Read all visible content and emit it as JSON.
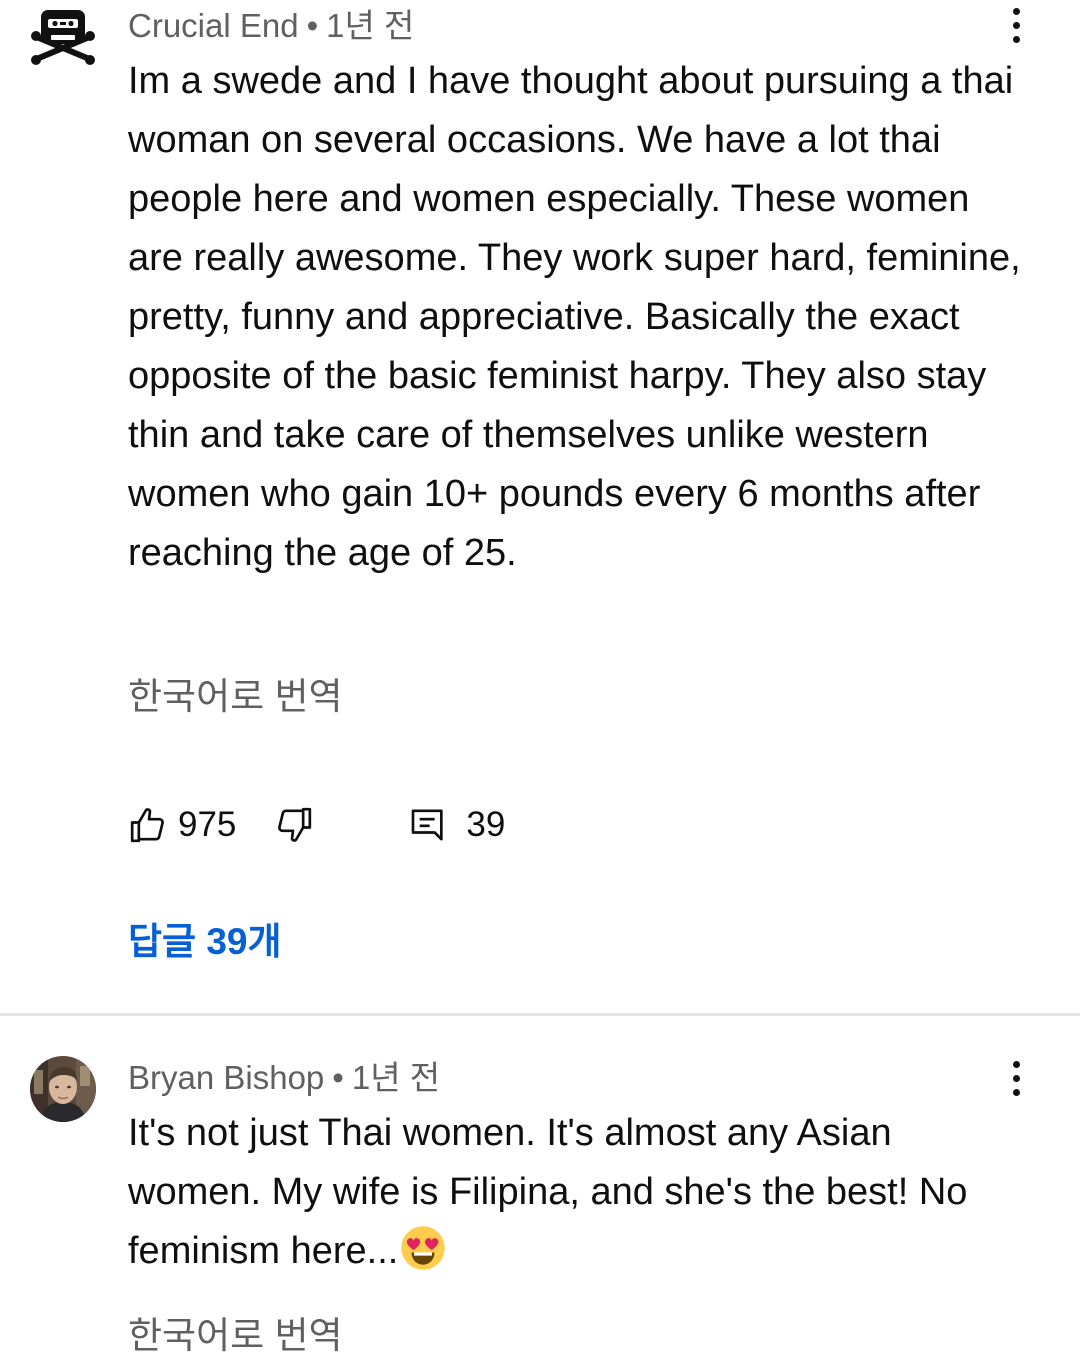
{
  "comments": [
    {
      "author": "Crucial End",
      "separator": "•",
      "time": "1년 전",
      "avatar_icon": "pirate-cassette-icon",
      "text": "Im a swede and I have thought about pursuing a thai woman on several occasions. We have a lot thai people here and women especially. These women are really awesome. They work super hard, feminine, pretty, funny and appreciative. Basically the exact opposite of the basic feminist harpy. They also stay thin and take care of themselves unlike western women who gain 10+ pounds every 6 months after reaching the age of 25.",
      "translate_label": "한국어로 번역",
      "likes": "975",
      "reply_count": "39",
      "replies_label": "답글 39개"
    },
    {
      "author": "Bryan Bishop",
      "separator": "•",
      "time": "1년 전",
      "avatar_icon": "user-photo-avatar",
      "text": "It's not just Thai women. It's almost any Asian women. My wife is Filipina, and she's the best! No feminism here...",
      "emoji": "heart-eyes-emoji",
      "translate_label": "한국어로 번역"
    }
  ],
  "colors": {
    "text_primary": "#0f0f0f",
    "text_secondary": "#606060",
    "link": "#065fd4",
    "divider": "#e5e5e5",
    "background": "#ffffff"
  }
}
